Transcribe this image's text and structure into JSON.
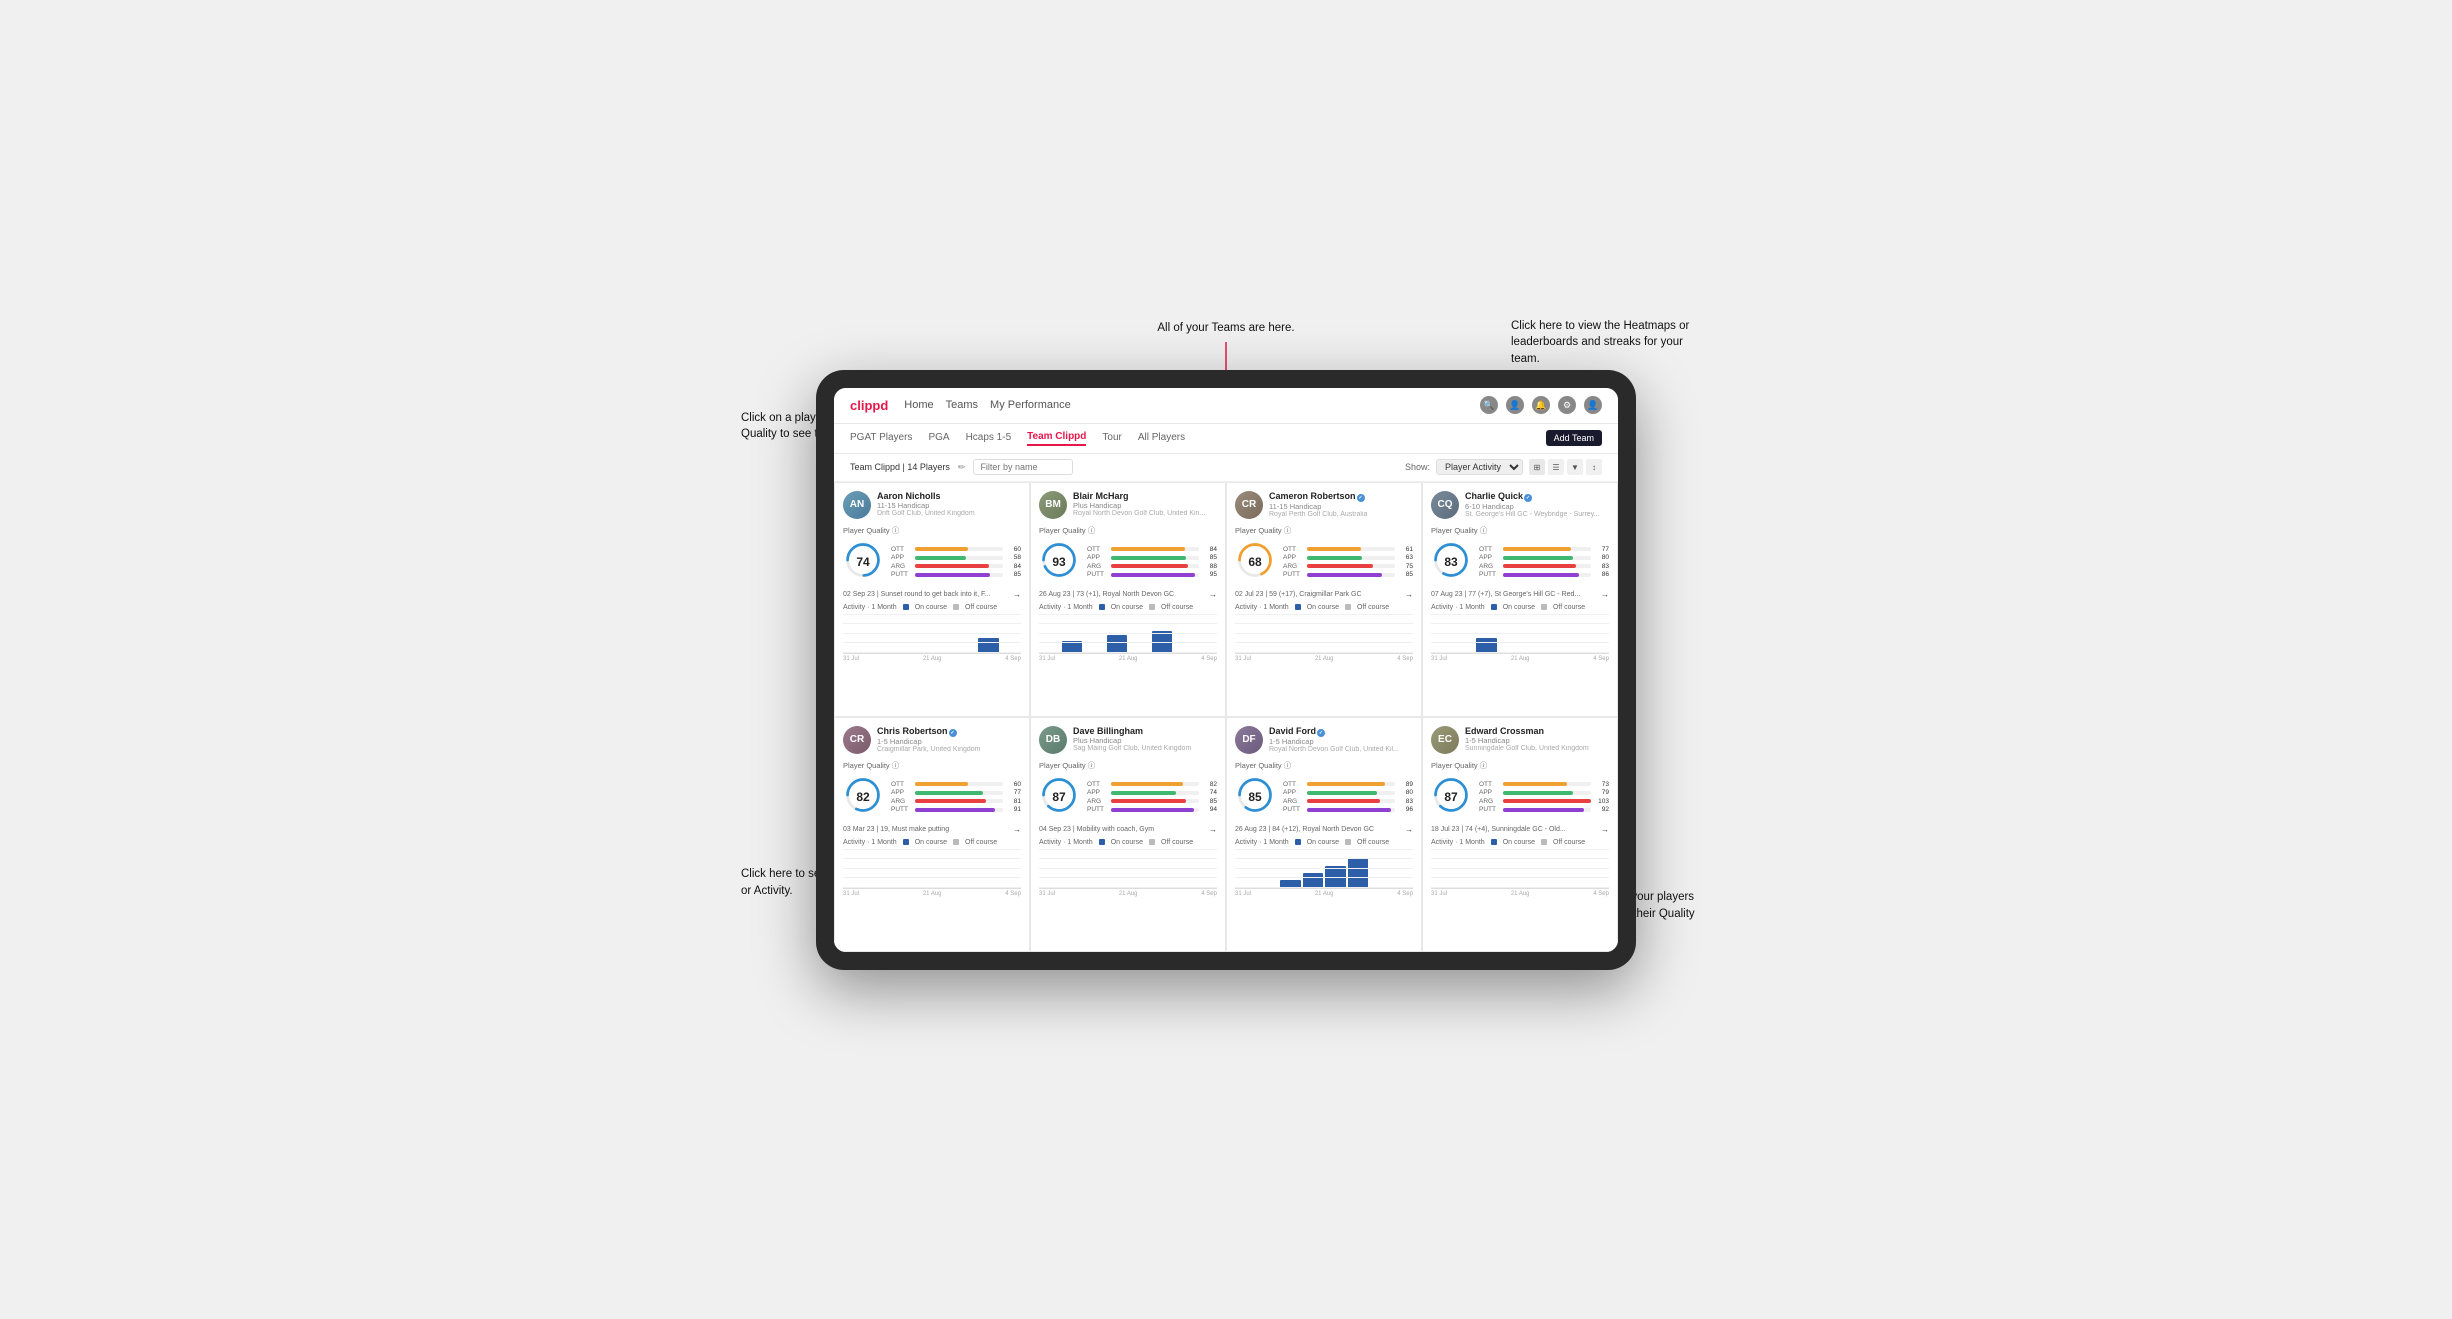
{
  "annotations": {
    "top_left": "Click on a players name\nor Player Quality to see\ntheir Dashboards.",
    "top_center": "All of your Teams are here.",
    "top_right": "Click here to view the\nHeatmaps or leaderboards\nand streaks for your team.",
    "bottom_left_1": "Click here to see their latest\nround or Activity.",
    "bottom_right": "Choose whether you see\nyour players Activities over\na month or their Quality\nScore Trend over a year."
  },
  "navbar": {
    "logo": "clippd",
    "links": [
      "Home",
      "Teams",
      "My Performance"
    ],
    "add_team": "Add Team"
  },
  "subnav": {
    "items": [
      "PGAT Players",
      "PGA",
      "Hcaps 1-5",
      "Team Clippd",
      "Tour",
      "All Players"
    ],
    "active": "Team Clippd"
  },
  "teambar": {
    "title": "Team Clippd | 14 Players",
    "show_label": "Show:",
    "show_value": "Player Activity",
    "filter_placeholder": "Filter by name"
  },
  "players": [
    {
      "name": "Aaron Nicholls",
      "handicap": "11-15 Handicap",
      "club": "Drift Golf Club, United Kingdom",
      "quality": 74,
      "quality_color": "#2d8fd4",
      "stats": {
        "OTT": {
          "value": 60,
          "pct": 60
        },
        "APP": {
          "value": 58,
          "pct": 58
        },
        "ARG": {
          "value": 84,
          "pct": 84
        },
        "PUTT": {
          "value": 85,
          "pct": 85
        }
      },
      "last_round": "02 Sep 23 | Sunset round to get back into it, F...",
      "bars": [
        0,
        0,
        0,
        0,
        0,
        0,
        15,
        0
      ],
      "avatar_initials": "AN",
      "avatar_class": "avatar-aaron"
    },
    {
      "name": "Blair McHarg",
      "handicap": "Plus Handicap",
      "club": "Royal North Devon Golf Club, United Kin...",
      "quality": 93,
      "quality_color": "#2d8fd4",
      "stats": {
        "OTT": {
          "value": 84,
          "pct": 84
        },
        "APP": {
          "value": 85,
          "pct": 85
        },
        "ARG": {
          "value": 88,
          "pct": 88
        },
        "PUTT": {
          "value": 95,
          "pct": 95
        }
      },
      "last_round": "26 Aug 23 | 73 (+1), Royal North Devon GC",
      "bars": [
        0,
        12,
        0,
        18,
        0,
        22,
        0,
        0
      ],
      "avatar_initials": "BM",
      "avatar_class": "avatar-blair"
    },
    {
      "name": "Cameron Robertson",
      "handicap": "11-15 Handicap",
      "club": "Royal Perth Golf Club, Australia",
      "quality": 68,
      "quality_color": "#f0a030",
      "stats": {
        "OTT": {
          "value": 61,
          "pct": 61
        },
        "APP": {
          "value": 63,
          "pct": 63
        },
        "ARG": {
          "value": 75,
          "pct": 75
        },
        "PUTT": {
          "value": 85,
          "pct": 85
        }
      },
      "last_round": "02 Jul 23 | 59 (+17), Craigmillar Park GC",
      "bars": [
        0,
        0,
        0,
        0,
        0,
        0,
        0,
        0
      ],
      "avatar_initials": "CR",
      "avatar_class": "avatar-cameron",
      "verified": true
    },
    {
      "name": "Charlie Quick",
      "handicap": "6-10 Handicap",
      "club": "St. George's Hill GC - Weybridge - Surrey...",
      "quality": 83,
      "quality_color": "#2d8fd4",
      "stats": {
        "OTT": {
          "value": 77,
          "pct": 77
        },
        "APP": {
          "value": 80,
          "pct": 80
        },
        "ARG": {
          "value": 83,
          "pct": 83
        },
        "PUTT": {
          "value": 86,
          "pct": 86
        }
      },
      "last_round": "07 Aug 23 | 77 (+7), St George's Hill GC - Red...",
      "bars": [
        0,
        0,
        15,
        0,
        0,
        0,
        0,
        0
      ],
      "avatar_initials": "CQ",
      "avatar_class": "avatar-charlie",
      "verified": true
    },
    {
      "name": "Chris Robertson",
      "handicap": "1-5 Handicap",
      "club": "Craigmillar Park, United Kingdom",
      "quality": 82,
      "quality_color": "#2d8fd4",
      "stats": {
        "OTT": {
          "value": 60,
          "pct": 60
        },
        "APP": {
          "value": 77,
          "pct": 77
        },
        "ARG": {
          "value": 81,
          "pct": 81
        },
        "PUTT": {
          "value": 91,
          "pct": 91
        }
      },
      "last_round": "03 Mar 23 | 19, Must make putting",
      "bars": [
        0,
        0,
        0,
        0,
        0,
        0,
        0,
        0
      ],
      "avatar_initials": "CR",
      "avatar_class": "avatar-chris",
      "verified": true
    },
    {
      "name": "Dave Billingham",
      "handicap": "Plus Handicap",
      "club": "Sag Maing Golf Club, United Kingdom",
      "quality": 87,
      "quality_color": "#2d8fd4",
      "stats": {
        "OTT": {
          "value": 82,
          "pct": 82
        },
        "APP": {
          "value": 74,
          "pct": 74
        },
        "ARG": {
          "value": 85,
          "pct": 85
        },
        "PUTT": {
          "value": 94,
          "pct": 94
        }
      },
      "last_round": "04 Sep 23 | Mobility with coach, Gym",
      "bars": [
        0,
        0,
        0,
        0,
        0,
        0,
        0,
        0
      ],
      "avatar_initials": "DB",
      "avatar_class": "avatar-dave"
    },
    {
      "name": "David Ford",
      "handicap": "1-5 Handicap",
      "club": "Royal North Devon Golf Club, United Kil...",
      "quality": 85,
      "quality_color": "#2d8fd4",
      "stats": {
        "OTT": {
          "value": 89,
          "pct": 89
        },
        "APP": {
          "value": 80,
          "pct": 80
        },
        "ARG": {
          "value": 83,
          "pct": 83
        },
        "PUTT": {
          "value": 96,
          "pct": 96
        }
      },
      "last_round": "26 Aug 23 | 84 (+12), Royal North Devon GC",
      "bars": [
        0,
        0,
        8,
        15,
        22,
        30,
        0,
        0
      ],
      "avatar_initials": "DF",
      "avatar_class": "avatar-david",
      "verified": true
    },
    {
      "name": "Edward Crossman",
      "handicap": "1-5 Handicap",
      "club": "Sunningdale Golf Club, United Kingdom",
      "quality": 87,
      "quality_color": "#2d8fd4",
      "stats": {
        "OTT": {
          "value": 73,
          "pct": 73
        },
        "APP": {
          "value": 79,
          "pct": 79
        },
        "ARG": {
          "value": 103,
          "pct": 100
        },
        "PUTT": {
          "value": 92,
          "pct": 92
        }
      },
      "last_round": "18 Jul 23 | 74 (+4), Sunningdale GC - Old...",
      "bars": [
        0,
        0,
        0,
        0,
        0,
        0,
        0,
        0
      ],
      "avatar_initials": "EC",
      "avatar_class": "avatar-edward"
    }
  ],
  "chart": {
    "dates": [
      "31 Jul",
      "21 Aug",
      "4 Sep"
    ],
    "activity_label": "Activity · 1 Month",
    "on_course": "On course",
    "off_course": "Off course"
  }
}
